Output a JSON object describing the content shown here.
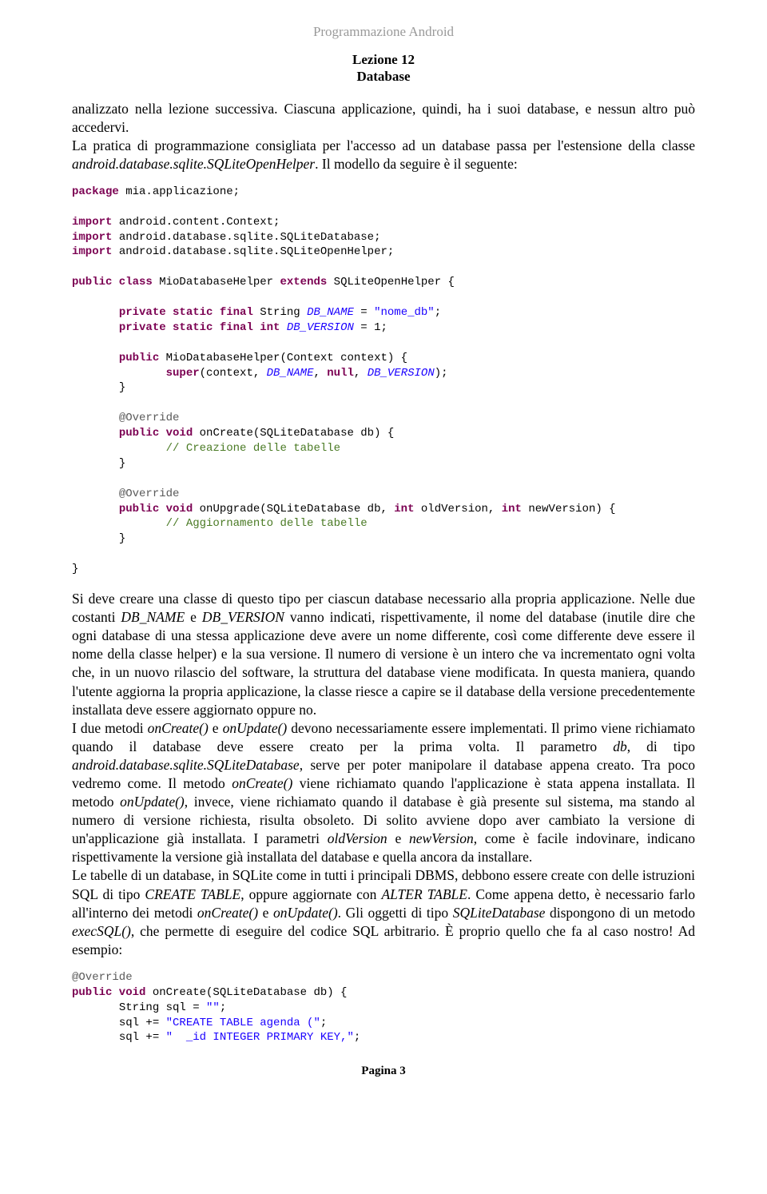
{
  "header": {
    "top": "Programmazione Android",
    "line1": "Lezione 12",
    "line2": "Database"
  },
  "paragraphs": {
    "p1_a": "analizzato nella lezione successiva. Ciascuna applicazione, quindi, ha i suoi database, e nessun altro può accedervi.",
    "p1_b_1": "La pratica di programmazione consigliata per l'accesso ad un database passa per l'estensione della classe ",
    "p1_b_class": "android.database.sqlite.SQLiteOpenHelper",
    "p1_b_2": ". Il modello da seguire è il seguente:",
    "p2_a": "Si deve creare una classe di questo tipo per ciascun database necessario alla propria applicazione. Nelle due costanti ",
    "p2_dbname": "DB_NAME",
    "p2_and": " e ",
    "p2_dbver": "DB_VERSION",
    "p2_b": " vanno indicati, rispettivamente, il nome del database (inutile dire che ogni database di una stessa applicazione deve avere un nome differente, così come differente deve essere il nome della classe helper) e la sua versione. Il numero di versione è un intero che va incrementato ogni volta che, in un nuovo rilascio del software, la struttura del database viene modificata. In questa maniera, quando l'utente aggiorna la propria applicazione, la classe riesce a capire se il database della versione precedentemente installata deve essere aggiornato oppure no.",
    "p3_a": "I due metodi ",
    "p3_m1": "onCreate()",
    "p3_and": " e ",
    "p3_m2": "onUpdate()",
    "p3_b": " devono necessariamente essere implementati. Il primo viene richiamato quando il database deve essere creato per la prima volta. Il parametro ",
    "p3_db": "db",
    "p3_c": ", di tipo ",
    "p3_type": "android.database.sqlite.SQLiteDatabase",
    "p3_d": ", serve per poter manipolare il database appena creato. Tra poco vedremo come. Il metodo ",
    "p3_m3": "onCreate()",
    "p3_e": " viene richiamato quando l'applicazione è stata appena installata. Il metodo ",
    "p3_m4": "onUpdate()",
    "p3_f": ", invece, viene richiamato quando il database è già presente sul sistema, ma stando al numero di versione richiesta, risulta obsoleto. Di solito avviene dopo aver cambiato la versione di un'applicazione già installata. I parametri ",
    "p3_ov": "oldVersion",
    "p3_and2": " e ",
    "p3_nv": "newVersion",
    "p3_g": ", come è facile indovinare, indicano rispettivamente la versione già installata del database e quella ancora da installare.",
    "p4_a": "Le tabelle di un database, in SQLite come in tutti i principali DBMS, debbono essere create con delle istruzioni SQL di tipo ",
    "p4_ct": "CREATE TABLE",
    "p4_b": ", oppure aggiornate con ",
    "p4_at": "ALTER TABLE",
    "p4_c": ". Come appena detto, è necessario farlo all'interno dei metodi ",
    "p4_m1": "onCreate()",
    "p4_and": " e ",
    "p4_m2": "onUpdate()",
    "p4_d": ". Gli oggetti di tipo ",
    "p4_sd": "SQLiteDatabase",
    "p4_e": " dispongono di un metodo ",
    "p4_es": "execSQL()",
    "p4_f": ", che permette di eseguire del codice SQL arbitrario. È proprio quello che fa al caso nostro! Ad esempio:"
  },
  "code1": {
    "l1_pre": "package",
    "l1_post": " mia.applicazione;",
    "l3_pre": "import",
    "l3_post": " android.content.Context;",
    "l4_pre": "import",
    "l4_post": " android.database.sqlite.SQLiteDatabase;",
    "l5_pre": "import",
    "l5_post": " android.database.sqlite.SQLiteOpenHelper;",
    "l7_a": "public class",
    "l7_b": " MioDatabaseHelper ",
    "l7_c": "extends",
    "l7_d": " SQLiteOpenHelper {",
    "l9_a": "private static final",
    "l9_b": " String ",
    "l9_c": "DB_NAME",
    "l9_d": " = ",
    "l9_e": "\"nome_db\"",
    "l9_f": ";",
    "l10_a": "private static final int",
    "l10_b": " ",
    "l10_c": "DB_VERSION",
    "l10_d": " = 1;",
    "l12_a": "public",
    "l12_b": " MioDatabaseHelper(Context context) {",
    "l13_a": "super",
    "l13_b": "(context, ",
    "l13_c": "DB_NAME",
    "l13_d": ", ",
    "l13_e": "null",
    "l13_f": ", ",
    "l13_g": "DB_VERSION",
    "l13_h": ");",
    "l14": "}",
    "l16": "@Override",
    "l17_a": "public void",
    "l17_b": " onCreate(SQLiteDatabase db) {",
    "l18": "// Creazione delle tabelle",
    "l19": "}",
    "l21": "@Override",
    "l22_a": "public void",
    "l22_b": " onUpgrade(SQLiteDatabase db, ",
    "l22_c": "int",
    "l22_d": " oldVersion, ",
    "l22_e": "int",
    "l22_f": " newVersion) {",
    "l23": "// Aggiornamento delle tabelle",
    "l24": "}",
    "l26": "}"
  },
  "code2": {
    "l1": "@Override",
    "l2_a": "public void",
    "l2_b": " onCreate(SQLiteDatabase db) {",
    "l3_a": "String sql = ",
    "l3_b": "\"\"",
    "l3_c": ";",
    "l4_a": "sql += ",
    "l4_b": "\"CREATE TABLE agenda (\"",
    "l4_c": ";",
    "l5_a": "sql += ",
    "l5_b": "\"  _id INTEGER PRIMARY KEY,\"",
    "l5_c": ";"
  },
  "footer": "Pagina 3"
}
